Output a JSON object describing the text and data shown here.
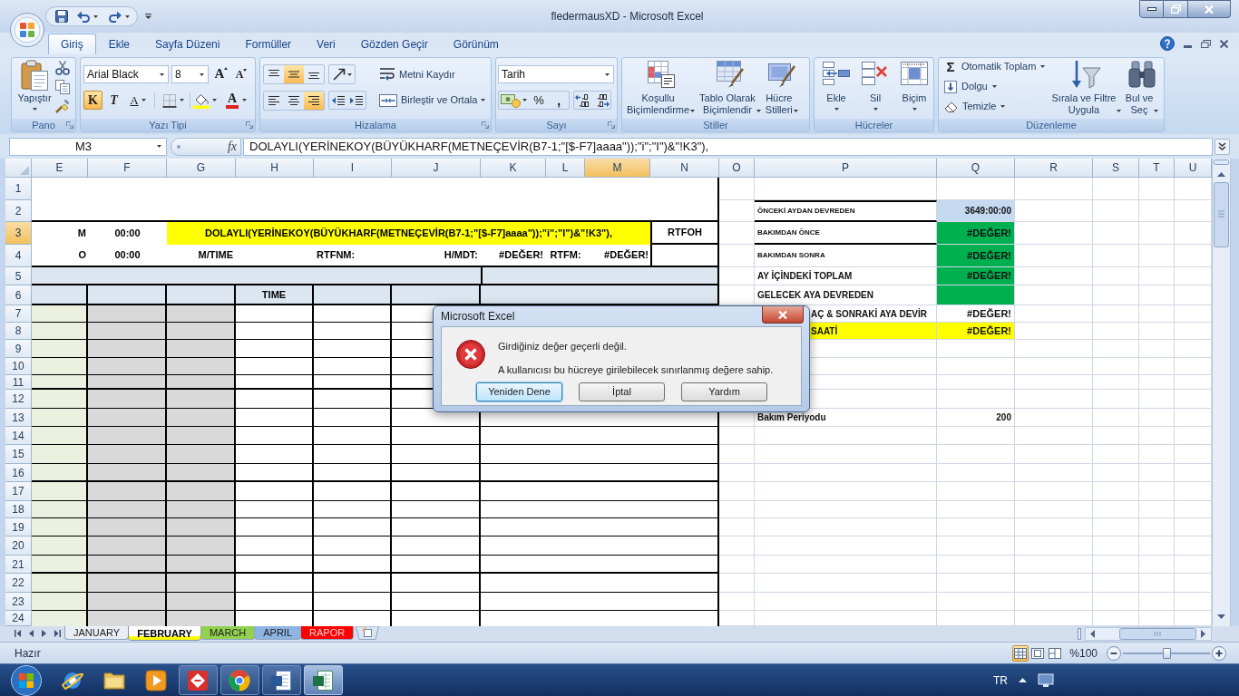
{
  "window": {
    "title": "fledermausXD - Microsoft Excel"
  },
  "ribbon_tabs": [
    {
      "label": "Giriş",
      "selected": true
    },
    {
      "label": "Ekle",
      "selected": false
    },
    {
      "label": "Sayfa Düzeni",
      "selected": false
    },
    {
      "label": "Formüller",
      "selected": false
    },
    {
      "label": "Veri",
      "selected": false
    },
    {
      "label": "Gözden Geçir",
      "selected": false
    },
    {
      "label": "Görünüm",
      "selected": false
    }
  ],
  "ribbon": {
    "groups": [
      {
        "kind": "clipboard",
        "label": "Pano",
        "paste": "Yapıştır"
      },
      {
        "kind": "font",
        "label": "Yazı Tipi",
        "font_name": "Arial Black",
        "font_size": "8",
        "grow": "A",
        "shrink": "A",
        "bold": {
          "glyph": "K",
          "on": true
        },
        "italic": {
          "glyph": "T",
          "on": false
        },
        "underline": {
          "glyph": "A",
          "on": false
        },
        "font_color": "A"
      },
      {
        "kind": "alignment",
        "label": "Hizalama",
        "vertical": [
          {
            "selected": false
          },
          {
            "selected": true
          },
          {
            "selected": false
          }
        ],
        "horizontal": [
          {
            "selected": false
          },
          {
            "selected": false
          },
          {
            "selected": true
          }
        ],
        "wrap": "Metni Kaydır",
        "merge": "Birleştir ve Ortala"
      },
      {
        "kind": "number",
        "label": "Sayı",
        "format": "Tarih",
        "percent": "%",
        "comma": ","
      },
      {
        "kind": "styles",
        "label": "Stiller",
        "buttons": [
          "Koşullu\nBiçimlendirme",
          "Tablo Olarak\nBiçimlendir",
          "Hücre\nStilleri"
        ]
      },
      {
        "kind": "cells",
        "label": "Hücreler",
        "buttons": [
          "Ekle",
          "Sil",
          "Biçim"
        ]
      },
      {
        "kind": "editing",
        "label": "Düzenleme",
        "autosum_glyph": "Σ",
        "autosum": "Otomatik Toplam",
        "fill": "Dolgu",
        "clear": "Temizle",
        "sort": "Sırala ve Filtre\nUygula",
        "find": "Bul ve\nSeç"
      }
    ]
  },
  "formula_bar": {
    "name_box": "M3",
    "fx": "fx",
    "formula": "DOLAYLI(YERİNEKOY(BÜYÜKHARF(METNEÇEVİR(B7-1;\"[$-F7]aaaa\"));\"i\";\"I\")&\"!K3\"),"
  },
  "sheet": {
    "columns": [
      {
        "label": "E",
        "selected": false
      },
      {
        "label": "F",
        "selected": false
      },
      {
        "label": "G",
        "selected": false
      },
      {
        "label": "H",
        "selected": false
      },
      {
        "label": "I",
        "selected": false
      },
      {
        "label": "J",
        "selected": false
      },
      {
        "label": "K",
        "selected": false
      },
      {
        "label": "L",
        "selected": false
      },
      {
        "label": "M",
        "selected": true
      },
      {
        "label": "N",
        "selected": false
      },
      {
        "label": "O",
        "selected": false
      },
      {
        "label": "P",
        "selected": false
      },
      {
        "label": "Q",
        "selected": false
      },
      {
        "label": "R",
        "selected": false
      },
      {
        "label": "S",
        "selected": false
      },
      {
        "label": "T",
        "selected": false
      },
      {
        "label": "U",
        "selected": false
      }
    ],
    "rows": [
      {
        "label": "1",
        "selected": false
      },
      {
        "label": "2",
        "selected": false,
        "summary": {
          "label": {
            "text": "ÖNCEKİ AYDAN DEVREDEN"
          },
          "value": {
            "text": "3649:00:00",
            "color": "#c5d9f1"
          }
        }
      },
      {
        "label": "3",
        "selected": true,
        "cells": [
          {
            "text": "M"
          },
          {
            "text": "00:00"
          },
          {
            "text": "DOLAYLI(YERİNEKOY(BÜYÜKHARF(METNEÇEVİR(B7-1;\"[$-F7]aaaa\"));\"i\";\"I\")&\"!K3\"),",
            "color": "#ffff00"
          },
          {
            "text": "RTFOH"
          }
        ],
        "summary": {
          "label": {
            "text": "BAKIMDAN ÖNCE"
          },
          "value": {
            "text": "#DEĞER!",
            "color": "#00b050"
          }
        }
      },
      {
        "label": "4",
        "selected": false,
        "cells": [
          {
            "text": "O"
          },
          {
            "text": "00:00"
          },
          {
            "text": "M/TIME"
          },
          {
            "text": "RTFNM:"
          },
          {
            "text": "H/MDT:"
          },
          {
            "text": "#DEĞER!"
          },
          {
            "text": "RTFM:"
          },
          {
            "text": "#DEĞER!"
          }
        ],
        "summary": {
          "label": {
            "text": "BAKIMDAN SONRA"
          },
          "value": {
            "text": "#DEĞER!",
            "color": "#00b050"
          }
        }
      },
      {
        "label": "5",
        "selected": false,
        "summary": {
          "label": {
            "text": "AY İÇİNDEKİ TOPLAM"
          },
          "value": {
            "text": "#DEĞER!",
            "color": "#00b050"
          }
        }
      },
      {
        "label": "6",
        "selected": false,
        "cells": [
          {
            "text": "TIME"
          }
        ],
        "summary": {
          "label": {
            "text": "GELECEK AYA DEVREDEN"
          },
          "value": {
            "color": "#00b050"
          }
        }
      },
      {
        "label": "7",
        "selected": false,
        "summary": {
          "label": {
            "text": "AÇ & SONRAKİ AYA DEVİR"
          },
          "value": {
            "text": "#DEĞER!"
          }
        }
      },
      {
        "label": "8",
        "selected": false,
        "summary": {
          "label": {
            "text": "SAATİ",
            "color": "#ffff00"
          },
          "value": {
            "text": "#DEĞER!",
            "color": "#ffff00"
          }
        }
      },
      {
        "label": "9",
        "selected": false
      },
      {
        "label": "10",
        "selected": false
      },
      {
        "label": "11",
        "selected": false
      },
      {
        "label": "12",
        "selected": false
      },
      {
        "label": "13",
        "selected": false,
        "summary": {
          "label": {
            "text": "Bakım Periyodu"
          },
          "value": {
            "text": "200"
          }
        }
      },
      {
        "label": "14",
        "selected": false
      },
      {
        "label": "15",
        "selected": false
      },
      {
        "label": "16",
        "selected": false
      },
      {
        "label": "17",
        "selected": false
      },
      {
        "label": "18",
        "selected": false
      },
      {
        "label": "19",
        "selected": false
      },
      {
        "label": "20",
        "selected": false
      },
      {
        "label": "21",
        "selected": false
      },
      {
        "label": "22",
        "selected": false
      },
      {
        "label": "23",
        "selected": false
      },
      {
        "label": "24",
        "selected": false
      }
    ]
  },
  "dialog": {
    "title": "Microsoft Excel",
    "messages": [
      "Girdiğiniz değer geçerli değil.",
      "A kullanıcısı bu hücreye girilebilecek sınırlanmış değere sahip."
    ],
    "buttons": [
      {
        "label": "Yeniden Dene",
        "selected": true
      },
      {
        "label": "İptal",
        "selected": false
      },
      {
        "label": "Yardım",
        "selected": false
      }
    ]
  },
  "sheet_tabs": [
    {
      "label": "JANUARY",
      "selected": false
    },
    {
      "label": "FEBRUARY",
      "selected": true,
      "color": "#ffff00"
    },
    {
      "label": "MARCH",
      "selected": false,
      "color": "#92d050"
    },
    {
      "label": "APRIL",
      "selected": false,
      "color": "#8db4e2"
    },
    {
      "label": "RAPOR",
      "selected": false,
      "color": "#ff0000"
    }
  ],
  "status_bar": {
    "text": "Hazır",
    "views": [
      {
        "selected": true
      },
      {
        "selected": false
      },
      {
        "selected": false
      }
    ],
    "zoom": "%100",
    "zoom_slider": {
      "level": 0.5
    }
  },
  "taskbar": {
    "apps": [
      {
        "running": false,
        "selected": false
      },
      {
        "running": false,
        "selected": false
      },
      {
        "running": false,
        "selected": false
      },
      {
        "running": true,
        "selected": false
      },
      {
        "running": true,
        "selected": false
      },
      {
        "running": true,
        "selected": false
      },
      {
        "running": true,
        "selected": true
      }
    ],
    "language": "TR"
  }
}
